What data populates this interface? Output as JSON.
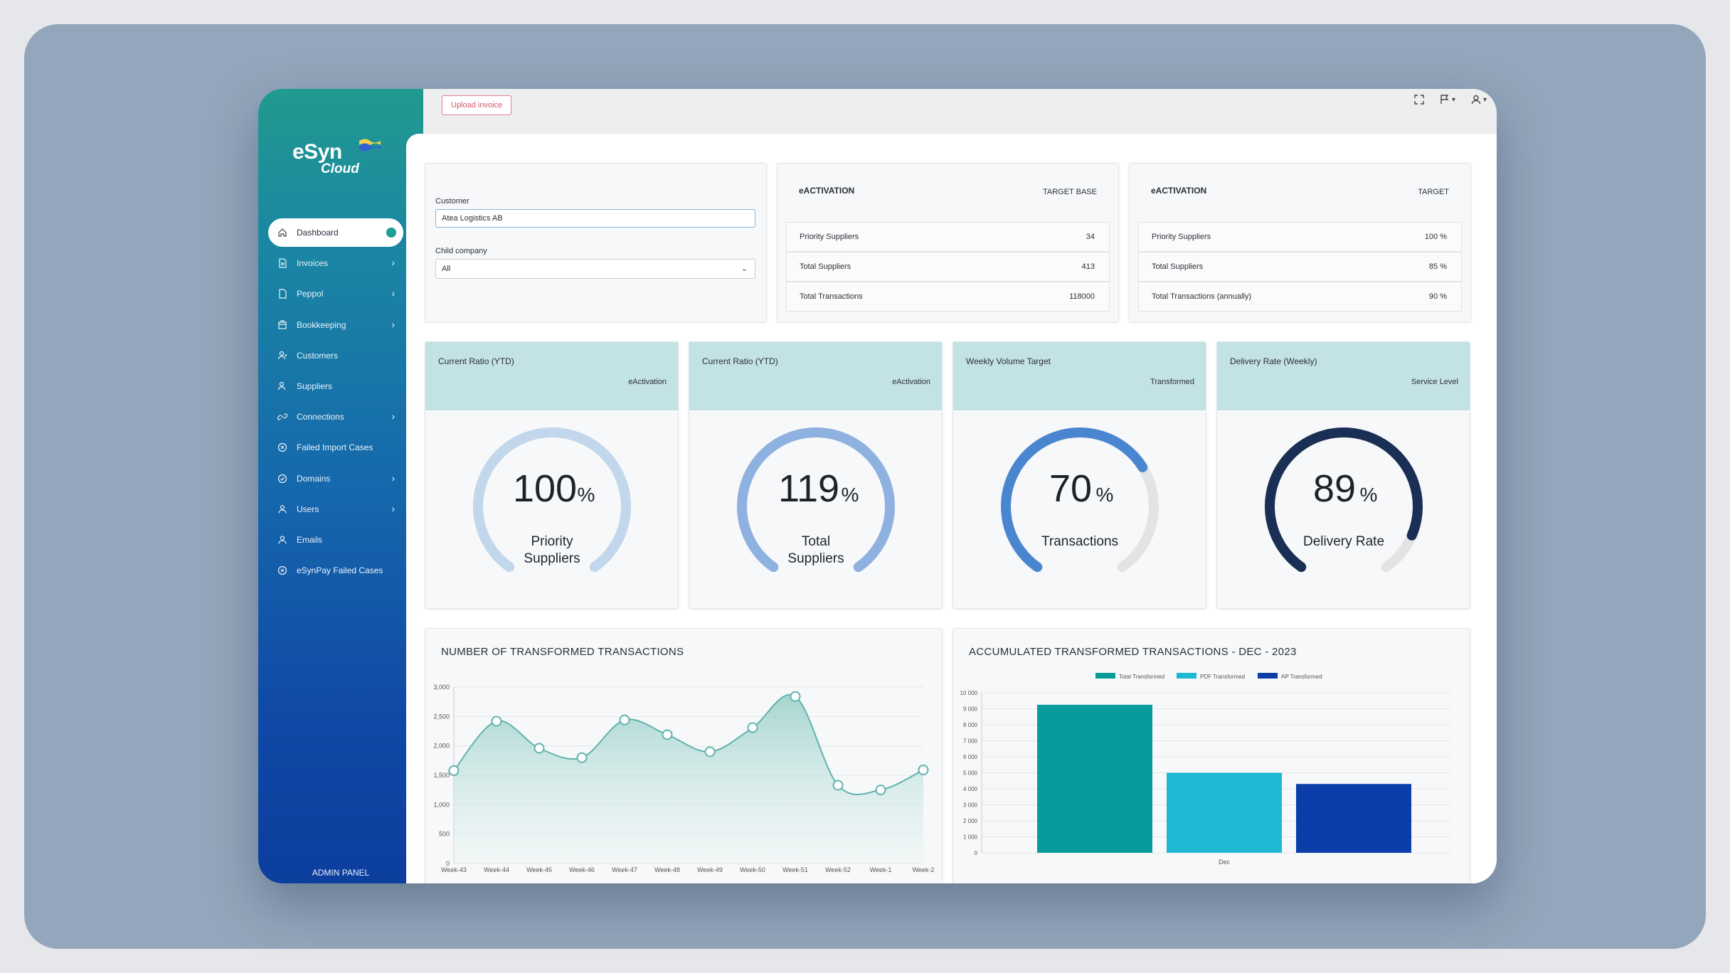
{
  "app": {
    "logo_text": "eSyn",
    "logo_sub": "Cloud",
    "admin_label": "ADMIN PANEL",
    "upload_label": "Upload invoice"
  },
  "sidebar": {
    "items": [
      {
        "label": "Dashboard",
        "icon": "home-icon",
        "active": true,
        "chevron": false
      },
      {
        "label": "Invoices",
        "icon": "document-icon",
        "chevron": true
      },
      {
        "label": "Peppol",
        "icon": "file-icon",
        "chevron": true
      },
      {
        "label": "Bookkeeping",
        "icon": "ledger-icon",
        "chevron": true
      },
      {
        "label": "Customers",
        "icon": "customers-icon",
        "chevron": false
      },
      {
        "label": "Suppliers",
        "icon": "suppliers-icon",
        "chevron": false
      },
      {
        "label": "Connections",
        "icon": "link-icon",
        "chevron": true
      },
      {
        "label": "Failed Import Cases",
        "icon": "x-circle-icon",
        "chevron": false
      },
      {
        "label": "Domains",
        "icon": "check-circle-icon",
        "chevron": true
      },
      {
        "label": "Users",
        "icon": "user-icon",
        "chevron": true
      },
      {
        "label": "Emails",
        "icon": "user-icon",
        "chevron": false
      },
      {
        "label": "eSynPay Failed Cases",
        "icon": "x-circle-icon",
        "chevron": false
      }
    ]
  },
  "filter": {
    "customer_label": "Customer",
    "customer_value": "Atea Logistics AB",
    "child_label": "Child company",
    "child_value": "All"
  },
  "target_base": {
    "title": "eACTIVATION",
    "col": "TARGET BASE",
    "rows": [
      {
        "k": "Priority Suppliers",
        "v": "34"
      },
      {
        "k": "Total Suppliers",
        "v": "413"
      },
      {
        "k": "Total Transactions",
        "v": "118000"
      }
    ]
  },
  "target": {
    "title": "eACTIVATION",
    "col": "TARGET",
    "rows": [
      {
        "k": "Priority Suppliers",
        "v": "100 %"
      },
      {
        "k": "Total Suppliers",
        "v": "85 %"
      },
      {
        "k": "Total Transactions (annually)",
        "v": "90 %"
      }
    ]
  },
  "gauges": [
    {
      "title": "Current Ratio (YTD)",
      "sub": "eActivation",
      "value": "100",
      "unit": "%",
      "label1": "Priority",
      "label2": "Suppliers",
      "fill": 1.0,
      "color": "#c2d6ec",
      "track": "#e4e6e8"
    },
    {
      "title": "Current Ratio (YTD)",
      "sub": "eActivation",
      "value": "119",
      "unit": "%",
      "label1": "Total",
      "label2": "Suppliers",
      "fill": 1.0,
      "color": "#8fb1e0",
      "track": "#e4e6e8"
    },
    {
      "title": "Weekly Volume Target",
      "sub": "Transformed",
      "value": "70",
      "unit": "%",
      "label1": "Transactions",
      "label2": "",
      "fill": 0.7,
      "color": "#4a86cf",
      "track": "#e2e3e5"
    },
    {
      "title": "Delivery Rate (Weekly)",
      "sub": "Service Level",
      "value": "89",
      "unit": "%",
      "label1": "Delivery Rate",
      "label2": "",
      "fill": 0.89,
      "color": "#1a2f56",
      "track": "#e2e3e5"
    }
  ],
  "line_chart_title": "NUMBER OF TRANSFORMED TRANSACTIONS",
  "bar_chart_title": "ACCUMULATED TRANSFORMED TRANSACTIONS - DEC - 2023",
  "chart_data": [
    {
      "type": "area",
      "title": "NUMBER OF TRANSFORMED TRANSACTIONS",
      "categories": [
        "Week-43",
        "Week-44",
        "Week-45",
        "Week-46",
        "Week-47",
        "Week-48",
        "Week-49",
        "Week-50",
        "Week-51",
        "Week-52",
        "Week-1",
        "Week-2"
      ],
      "series": [
        {
          "values": [
            1580,
            2420,
            1960,
            1800,
            2440,
            2190,
            1900,
            2310,
            2840,
            1330,
            1250,
            1590
          ]
        }
      ],
      "ylim": [
        0,
        3000
      ],
      "yticks": [
        "0",
        "500",
        "1,000",
        "1,500",
        "2,000",
        "2,500",
        "3,000"
      ],
      "grid": true,
      "color": "#5fb3ad"
    },
    {
      "type": "bar",
      "title": "ACCUMULATED TRANSFORMED TRANSACTIONS - DEC - 2023",
      "categories": [
        "Dec"
      ],
      "series": [
        {
          "name": "Total Transformed",
          "values": [
            9250
          ],
          "color": "#089b9b"
        },
        {
          "name": "PDF Transformed",
          "values": [
            5000
          ],
          "color": "#1eb8d4"
        },
        {
          "name": "AP Transformed",
          "values": [
            4300
          ],
          "color": "#0b3ea8"
        }
      ],
      "ylim": [
        0,
        10000
      ],
      "yticks": [
        "0",
        "1 000",
        "2 000",
        "3 000",
        "4 000",
        "5 000",
        "6 000",
        "7 000",
        "8 000",
        "9 000",
        "10 000"
      ],
      "legend": "top-center",
      "grid": true
    }
  ]
}
